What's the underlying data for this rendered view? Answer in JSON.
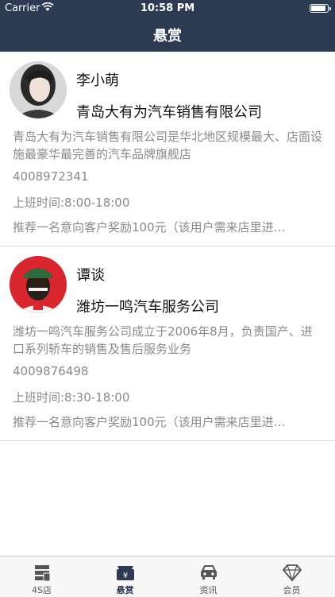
{
  "status": {
    "carrier": "Carrier",
    "time": "10:58 PM"
  },
  "nav": {
    "title": "悬赏"
  },
  "items": [
    {
      "name": "李小萌",
      "company": "青岛大有为汽车销售有限公司",
      "description": "青岛大有为汽车销售有限公司是华北地区规模最大、店面设施最豪华最完善的汽车品牌旗舰店",
      "phone": "4008972341",
      "hours": "上班时间:8:00-18:00",
      "reward": "推荐一名意向客户奖励100元（该用户需来店里进…"
    },
    {
      "name": "谭谈",
      "company": "潍坊一鸣汽车服务公司",
      "description": "潍坊一鸣汽车服务公司成立于2006年8月，负责国产、进口系列轿车的销售及售后服务业务",
      "phone": "4009876498",
      "hours": "上班时间:8:30-18:00",
      "reward": "推荐一名意向客户奖励100元（该用户需来店里进…"
    }
  ],
  "tabs": [
    {
      "label": "4S店",
      "icon": "store-icon"
    },
    {
      "label": "悬赏",
      "icon": "reward-icon"
    },
    {
      "label": "资讯",
      "icon": "car-icon"
    },
    {
      "label": "会员",
      "icon": "diamond-icon"
    }
  ],
  "colors": {
    "header": "#2c3a52",
    "text_secondary": "#8a8a8a"
  }
}
